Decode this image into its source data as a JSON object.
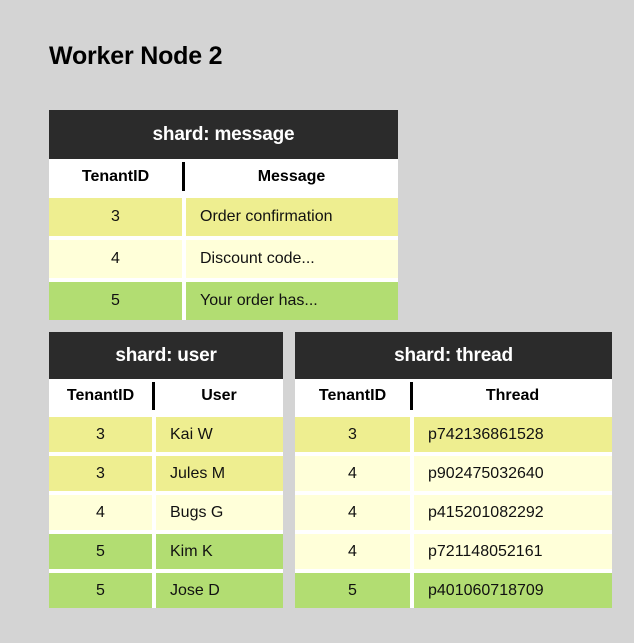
{
  "page": {
    "title": "Worker Node 2",
    "background_color": "#d4d4d4"
  },
  "palette": {
    "header_bg": "#2b2b2b",
    "header_text": "#ffffff",
    "tint_yellow": "#eeee90",
    "tint_pale": "#ffffd9",
    "tint_green": "#b2dd72",
    "cell_text": "#111111"
  },
  "tables": [
    {
      "id": "message",
      "header": "shard: message",
      "columns": [
        "TenantID",
        "Message"
      ],
      "rows": [
        {
          "tenant_id": "3",
          "value": "Order confirmation",
          "tint": "#eeee90"
        },
        {
          "tenant_id": "4",
          "value": "Discount code...",
          "tint": "#ffffd9"
        },
        {
          "tenant_id": "5",
          "value": "Your order has...",
          "tint": "#b2dd72"
        }
      ]
    },
    {
      "id": "user",
      "header": "shard: user",
      "columns": [
        "TenantID",
        "User"
      ],
      "rows": [
        {
          "tenant_id": "3",
          "value": "Kai W",
          "tint": "#eeee90"
        },
        {
          "tenant_id": "3",
          "value": "Jules M",
          "tint": "#eeee90"
        },
        {
          "tenant_id": "4",
          "value": "Bugs G",
          "tint": "#ffffd9"
        },
        {
          "tenant_id": "5",
          "value": "Kim K",
          "tint": "#b2dd72"
        },
        {
          "tenant_id": "5",
          "value": "Jose D",
          "tint": "#b2dd72"
        }
      ]
    },
    {
      "id": "thread",
      "header": "shard: thread",
      "columns": [
        "TenantID",
        "Thread"
      ],
      "rows": [
        {
          "tenant_id": "3",
          "value": "p742136861528",
          "tint": "#eeee90"
        },
        {
          "tenant_id": "4",
          "value": "p902475032640",
          "tint": "#ffffd9"
        },
        {
          "tenant_id": "4",
          "value": "p415201082292",
          "tint": "#ffffd9"
        },
        {
          "tenant_id": "4",
          "value": "p721148052161",
          "tint": "#ffffd9"
        },
        {
          "tenant_id": "5",
          "value": "p401060718709",
          "tint": "#b2dd72"
        }
      ]
    }
  ]
}
